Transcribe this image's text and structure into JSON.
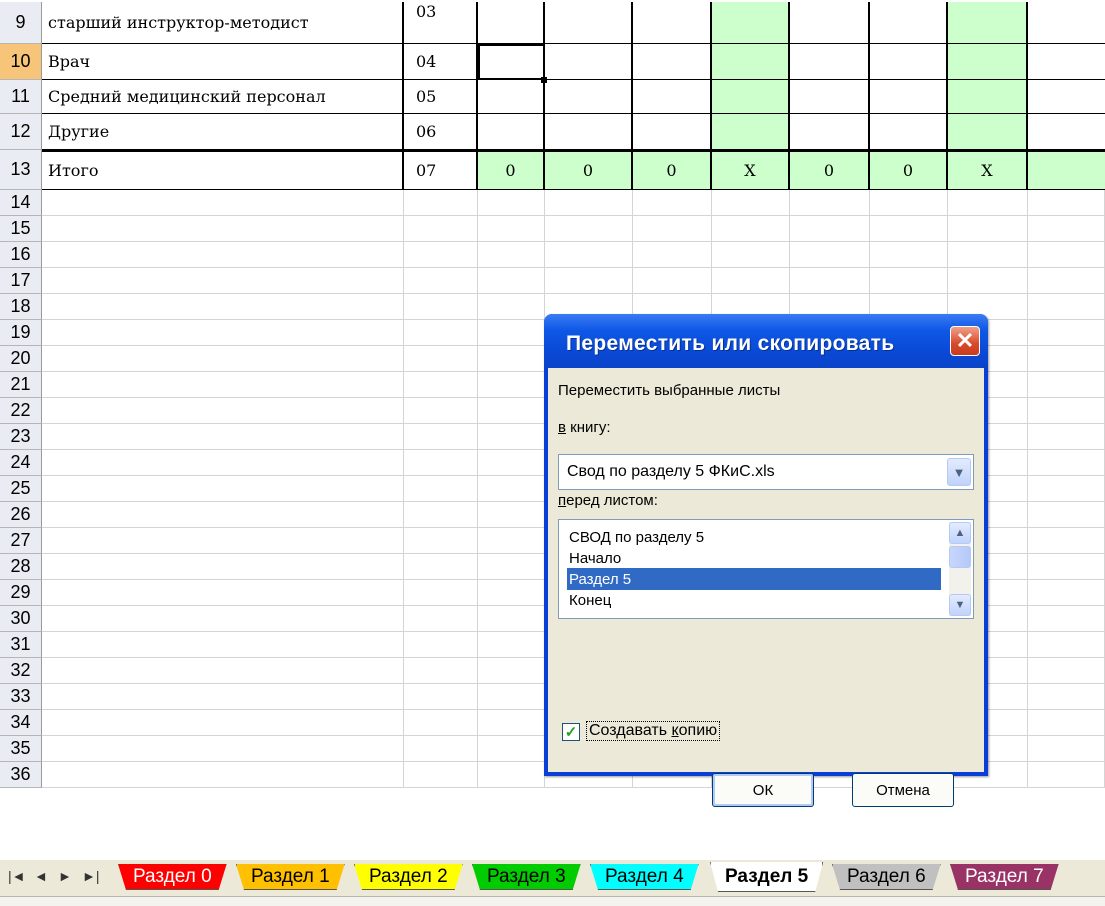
{
  "rows": [
    {
      "num": "9",
      "name": "старший инструктор-методист",
      "code": "03",
      "code_top": true
    },
    {
      "num": "10",
      "name": "Врач",
      "code": "04"
    },
    {
      "num": "11",
      "name": "Средний медицинский персонал",
      "code": "05"
    },
    {
      "num": "12",
      "name": "Другие",
      "code": "06"
    },
    {
      "num": "13",
      "name": "Итого",
      "code": "07",
      "values": [
        "0",
        "0",
        "0",
        "Х",
        "0",
        "0",
        "Х"
      ]
    }
  ],
  "empty_row_numbers": [
    "14",
    "15",
    "16",
    "17",
    "18",
    "19",
    "20",
    "21",
    "22",
    "23",
    "24",
    "25",
    "26",
    "27",
    "28",
    "29",
    "30",
    "31",
    "32",
    "33",
    "34",
    "35",
    "36"
  ],
  "dialog": {
    "title": "Переместить или скопировать",
    "close_symbol": "✕",
    "move_label": "Переместить выбранные листы",
    "book_label_u": "в",
    "book_label_rest": " книгу:",
    "book_value": "Свод по разделу 5 ФКиС.xls",
    "before_label_u": "п",
    "before_label_rest": "еред листом:",
    "sheets": [
      "СВОД по разделу 5",
      "Начало",
      "Раздел 5",
      "Конец"
    ],
    "selected_sheet": "Раздел 5",
    "copy_label_pre": "Создавать ",
    "copy_label_u": "к",
    "copy_label_post": "опию",
    "copy_checked": true,
    "ok_label": "ОК",
    "cancel_label": "Отмена"
  },
  "tabs": [
    {
      "label": "Раздел 0",
      "color": "#ff0000",
      "text_color": "#ffffff"
    },
    {
      "label": "Раздел 1",
      "color": "#ffc000",
      "text_color": "#000000"
    },
    {
      "label": "Раздел 2",
      "color": "#ffff00",
      "text_color": "#000000"
    },
    {
      "label": "Раздел 3",
      "color": "#00cc00",
      "text_color": "#000000"
    },
    {
      "label": "Раздел 4",
      "color": "#00ffff",
      "text_color": "#000000"
    },
    {
      "label": "Раздел 5",
      "color": "#ffffff",
      "text_color": "#000000",
      "active": true
    },
    {
      "label": "Раздел 6",
      "color": "#c0c0c0",
      "text_color": "#000000"
    },
    {
      "label": "Раздел 7",
      "color": "#993366",
      "text_color": "#ffffff"
    }
  ],
  "nav": [
    "◄◄",
    "◄",
    "►",
    "►►"
  ]
}
